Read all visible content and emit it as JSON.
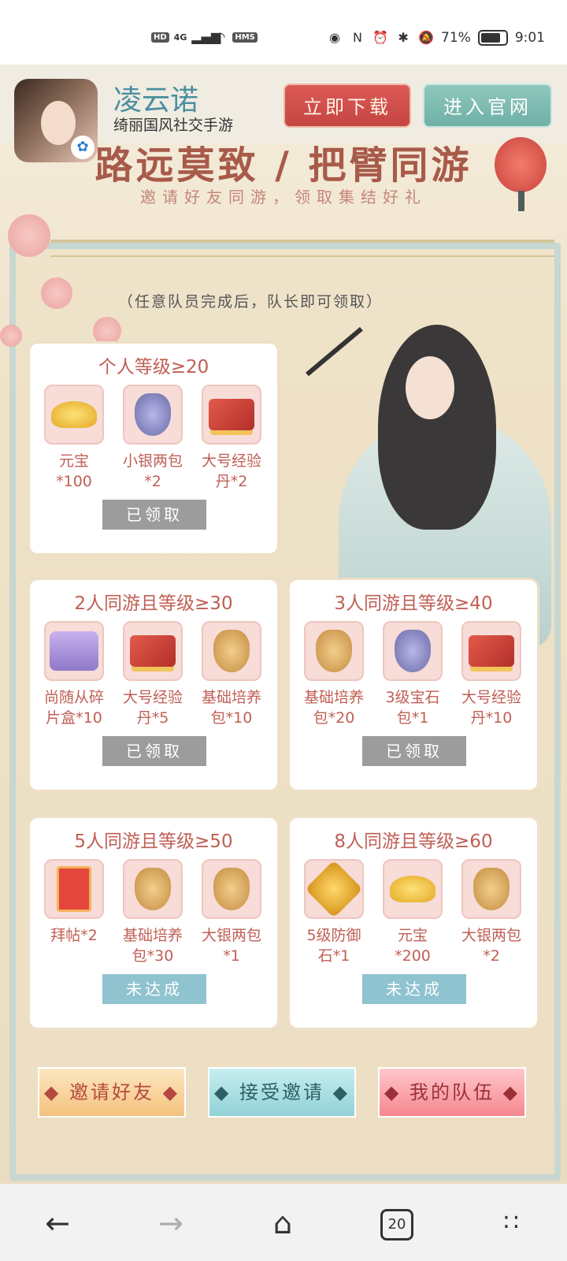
{
  "status_bar": {
    "left_badges": [
      "HD",
      "4G"
    ],
    "battery": "71%",
    "time": "9:01"
  },
  "header": {
    "app_name": "凌云诺",
    "app_subtitle": "绮丽国风社交手游",
    "download_label": "立即下载",
    "official_label": "进入官网"
  },
  "banner": {
    "slogan": "路远莫致 / 把臂同游",
    "subtitle": "邀请好友同游，领取集结好礼"
  },
  "note": "（任意队员完成后，队长即可领取）",
  "cards": [
    {
      "title": "个人等级≥20",
      "items": [
        {
          "label": "元宝*100",
          "icon": "gold-ingot-icon"
        },
        {
          "label": "小银两包*2",
          "icon": "silver-bag-icon"
        },
        {
          "label": "大号经验丹*2",
          "icon": "exp-pill-icon"
        }
      ],
      "action": "已领取",
      "state": "claimed"
    },
    {
      "title": "2人同游且等级≥30",
      "items": [
        {
          "label": "尚随从碎片盒*10",
          "icon": "chest-icon"
        },
        {
          "label": "大号经验丹*5",
          "icon": "exp-pill-icon"
        },
        {
          "label": "基础培养包*10",
          "icon": "cultivation-bag-icon"
        }
      ],
      "action": "已领取",
      "state": "claimed"
    },
    {
      "title": "3人同游且等级≥40",
      "items": [
        {
          "label": "基础培养包*20",
          "icon": "cultivation-bag-icon"
        },
        {
          "label": "3级宝石包*1",
          "icon": "gem-bag-icon"
        },
        {
          "label": "大号经验丹*10",
          "icon": "exp-pill-icon"
        }
      ],
      "action": "已领取",
      "state": "claimed"
    },
    {
      "title": "5人同游且等级≥50",
      "items": [
        {
          "label": "拜帖*2",
          "icon": "invitation-card-icon"
        },
        {
          "label": "基础培养包*30",
          "icon": "cultivation-bag-icon"
        },
        {
          "label": "大银两包*1",
          "icon": "big-silver-bag-icon"
        }
      ],
      "action": "未达成",
      "state": "unfinished"
    },
    {
      "title": "8人同游且等级≥60",
      "items": [
        {
          "label": "5级防御石*1",
          "icon": "defense-stone-icon"
        },
        {
          "label": "元宝*200",
          "icon": "gold-ingot-icon"
        },
        {
          "label": "大银两包*2",
          "icon": "big-silver-bag-icon"
        }
      ],
      "action": "未达成",
      "state": "unfinished"
    }
  ],
  "bottom_buttons": {
    "invite": "◆ 邀请好友 ◆",
    "accept": "◆ 接受邀请 ◆",
    "team": "◆ 我的队伍 ◆"
  },
  "nav": {
    "tabs_count": "20"
  }
}
